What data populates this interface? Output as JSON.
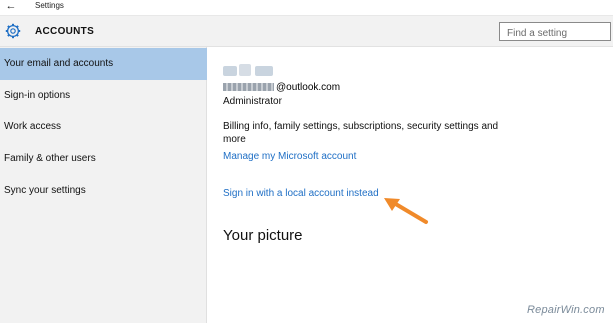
{
  "titlebar": {
    "back_icon": "back-arrow-icon",
    "title": "Settings"
  },
  "header": {
    "icon": "gear-icon",
    "title": "ACCOUNTS",
    "search": {
      "placeholder": "Find a setting",
      "value": ""
    }
  },
  "sidebar": {
    "items": [
      {
        "label": "Your email and accounts",
        "selected": true
      },
      {
        "label": "Sign-in options",
        "selected": false
      },
      {
        "label": "Work access",
        "selected": false
      },
      {
        "label": "Family & other users",
        "selected": false
      },
      {
        "label": "Sync your settings",
        "selected": false
      }
    ],
    "selected_color": "#a8c8e8"
  },
  "main": {
    "account": {
      "email_domain": "@outlook.com",
      "role": "Administrator"
    },
    "billing_text": "Billing info, family settings, subscriptions, security settings and more",
    "manage_link": "Manage my Microsoft account",
    "local_link": "Sign in with a local account instead",
    "annotation_icon": "orange-arrow-icon",
    "picture_heading": "Your picture"
  },
  "colors": {
    "link": "#1f6fc5",
    "arrow": "#f08a2a",
    "sidebar_bg": "#f2f2f2"
  },
  "watermark": "RepairWin.com"
}
